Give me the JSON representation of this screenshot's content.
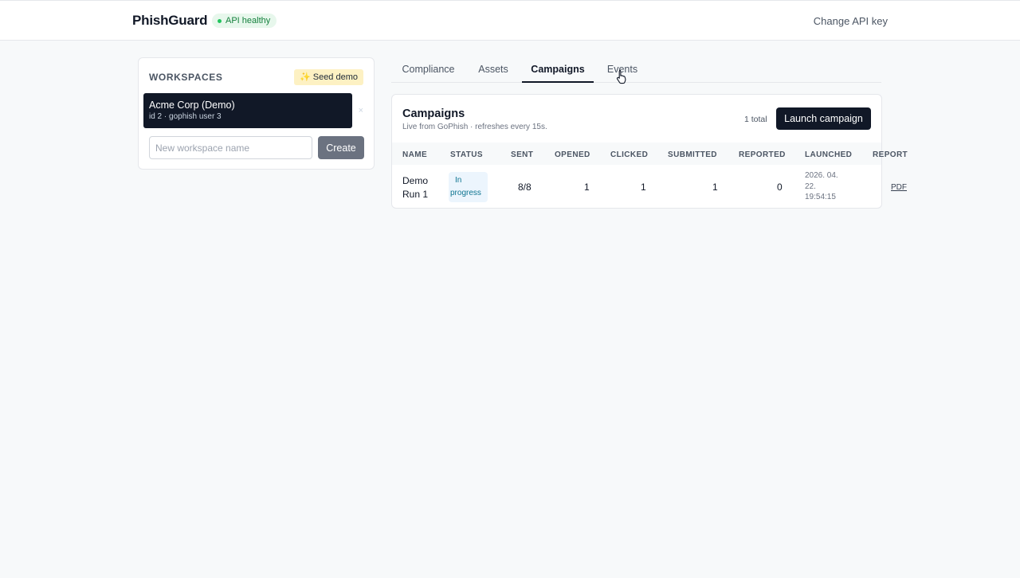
{
  "header": {
    "brand": "PhishGuard",
    "health_badge": "API healthy",
    "change_api_key": "Change API key"
  },
  "workspaces": {
    "title": "WORKSPACES",
    "seed_demo": "Seed demo",
    "items": [
      {
        "name": "Acme Corp (Demo)",
        "subtitle": "id 2 · gophish user 3",
        "remove": "×"
      }
    ],
    "new_placeholder": "New workspace name",
    "create_label": "Create"
  },
  "tabs": [
    {
      "label": "Compliance",
      "active": false
    },
    {
      "label": "Assets",
      "active": false
    },
    {
      "label": "Campaigns",
      "active": true
    },
    {
      "label": "Events",
      "active": false
    }
  ],
  "campaigns": {
    "title": "Campaigns",
    "subtitle": "Live from GoPhish · refreshes every 15s.",
    "total": "1 total",
    "launch_label": "Launch campaign",
    "columns": [
      "NAME",
      "STATUS",
      "SENT",
      "OPENED",
      "CLICKED",
      "SUBMITTED",
      "REPORTED",
      "LAUNCHED",
      "REPORT"
    ],
    "rows": [
      {
        "name_line1": "Demo",
        "name_line2": "Run 1",
        "status_line1": "In",
        "status_line2": "progress",
        "sent": "8/8",
        "opened": "1",
        "clicked": "1",
        "submitted": "1",
        "reported": "0",
        "launched_line1": "2026. 04.",
        "launched_line2": "22.",
        "launched_line3": "19:54:15",
        "report": "PDF"
      }
    ]
  },
  "colors": {
    "accent_dark": "#111827",
    "health_green": "#15803d",
    "seed_yellow": "#fdf1c3",
    "status_blue": "#0e7490"
  }
}
